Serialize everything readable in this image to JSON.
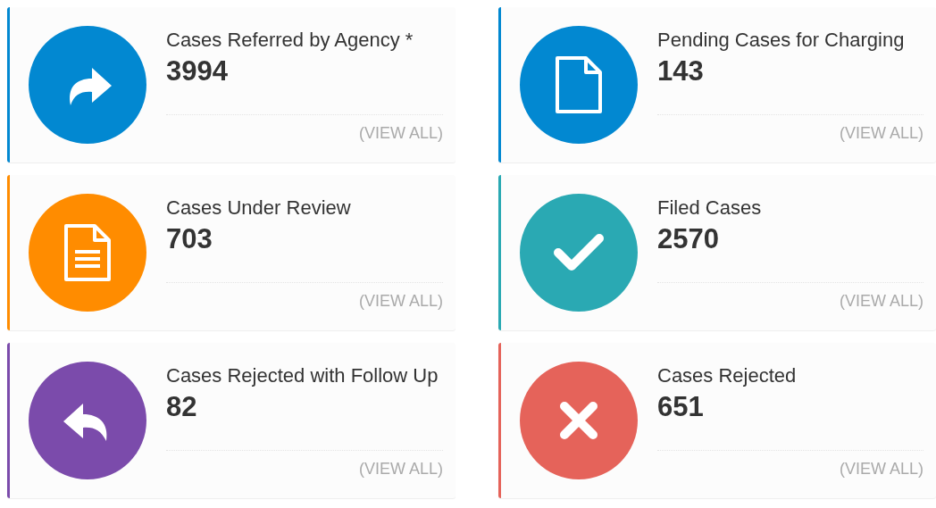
{
  "cards": [
    {
      "title": "Cases Referred by Agency *",
      "count": "3994",
      "link": "(VIEW ALL)",
      "color": "#0288d1",
      "kind": "forward"
    },
    {
      "title": "Pending Cases for Charging",
      "count": "143",
      "link": "(VIEW ALL)",
      "color": "#0288d1",
      "kind": "file"
    },
    {
      "title": "Cases Under Review",
      "count": "703",
      "link": "(VIEW ALL)",
      "color": "#ff8c00",
      "kind": "document"
    },
    {
      "title": "Filed Cases",
      "count": "2570",
      "link": "(VIEW ALL)",
      "color": "#2aa9b3",
      "kind": "check"
    },
    {
      "title": "Cases Rejected with Follow Up",
      "count": "82",
      "link": "(VIEW ALL)",
      "color": "#7b4bab",
      "kind": "reply"
    },
    {
      "title": "Cases Rejected",
      "count": "651",
      "link": "(VIEW ALL)",
      "color": "#e5635a",
      "kind": "cross"
    }
  ]
}
